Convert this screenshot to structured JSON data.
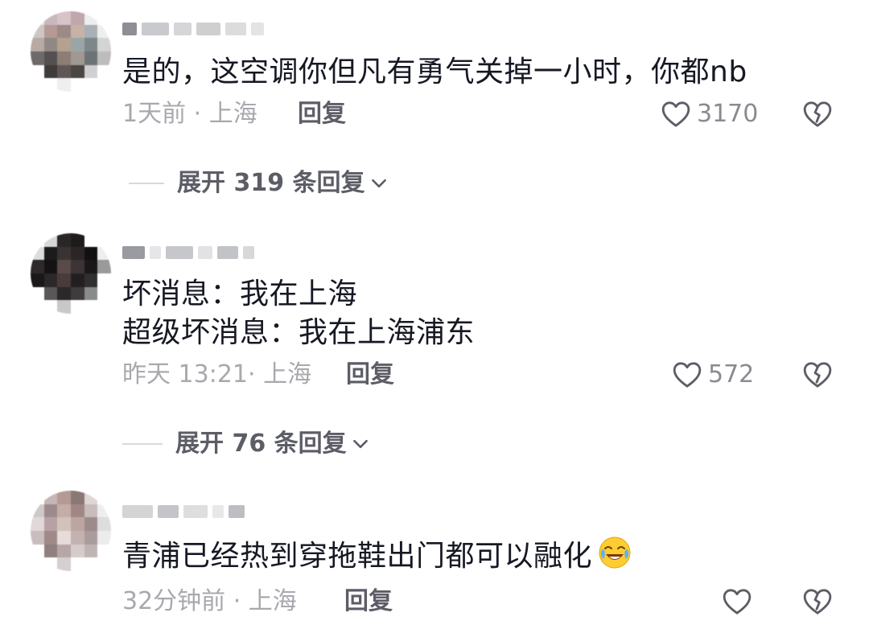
{
  "comments": [
    {
      "text": "是的，这空调你但凡有勇气关掉一小时，你都nb",
      "meta": "1天前 · 上海",
      "reply_label": "回复",
      "likes": "3170",
      "expand_label": "展开 319 条回复"
    },
    {
      "text_line1": "坏消息：我在上海",
      "text_line2": "超级坏消息：我在上海浦东",
      "meta": "昨天 13:21· 上海",
      "reply_label": "回复",
      "likes": "572",
      "expand_label": "展开 76 条回复"
    },
    {
      "text": "青浦已经热到穿拖鞋出门都可以融化",
      "emoji": "laughing-crying-emoji",
      "meta": "32分钟前 · 上海",
      "reply_label": "回复",
      "likes": ""
    }
  ],
  "icons": {
    "like": "heart-outline-icon",
    "dislike": "broken-heart-icon",
    "expand": "chevron-down-icon"
  },
  "colors": {
    "text": "#161823",
    "meta": "#a8a9ae",
    "action": "#5c5d66",
    "icon": "#5c5d66"
  }
}
